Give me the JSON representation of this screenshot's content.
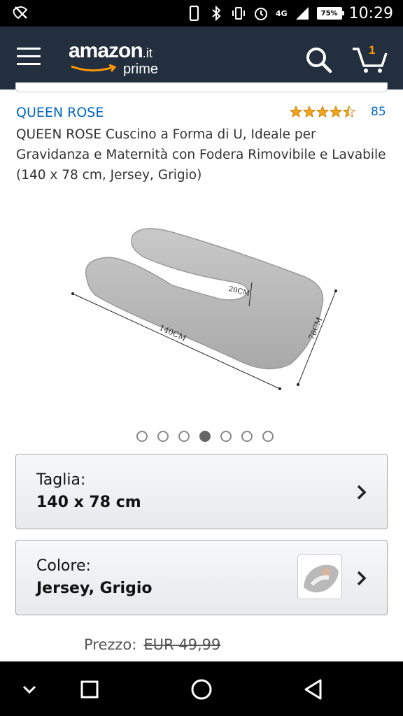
{
  "status_bar": {
    "network": "4G",
    "battery": "75%",
    "time": "10:29"
  },
  "header": {
    "logo_text": "amazon",
    "logo_tld": ".it",
    "logo_sub": "prime",
    "cart_count": "1",
    "accent_color": "#f90",
    "bg_color": "#232f3e"
  },
  "product": {
    "brand": "QUEEN ROSE",
    "rating": 4.5,
    "review_count": "85",
    "title": "QUEEN ROSE Cuscino a Forma di U, Ideale per Gravidanza e Maternità con Fodera Rimovibile e Lavabile (140 x 78 cm, Jersey, Grigio)",
    "image_labels": {
      "length": "140CM",
      "width": "78CM",
      "thickness": "20CM"
    },
    "carousel": {
      "count": 7,
      "active_index": 3
    }
  },
  "size_selector": {
    "label": "Taglia:",
    "value": "140 x 78 cm"
  },
  "color_selector": {
    "label": "Colore:",
    "value": "Jersey, Grigio"
  },
  "price": {
    "label": "Prezzo:",
    "old_price": "EUR 49,99"
  },
  "icons": {
    "status_left": "location-off-icon",
    "menu": "menu-icon",
    "search": "search-icon",
    "cart": "cart-icon",
    "chevron": "chevron-right-icon",
    "nav": [
      "chevron-down-icon",
      "square-icon",
      "circle-icon",
      "triangle-back-icon"
    ]
  }
}
